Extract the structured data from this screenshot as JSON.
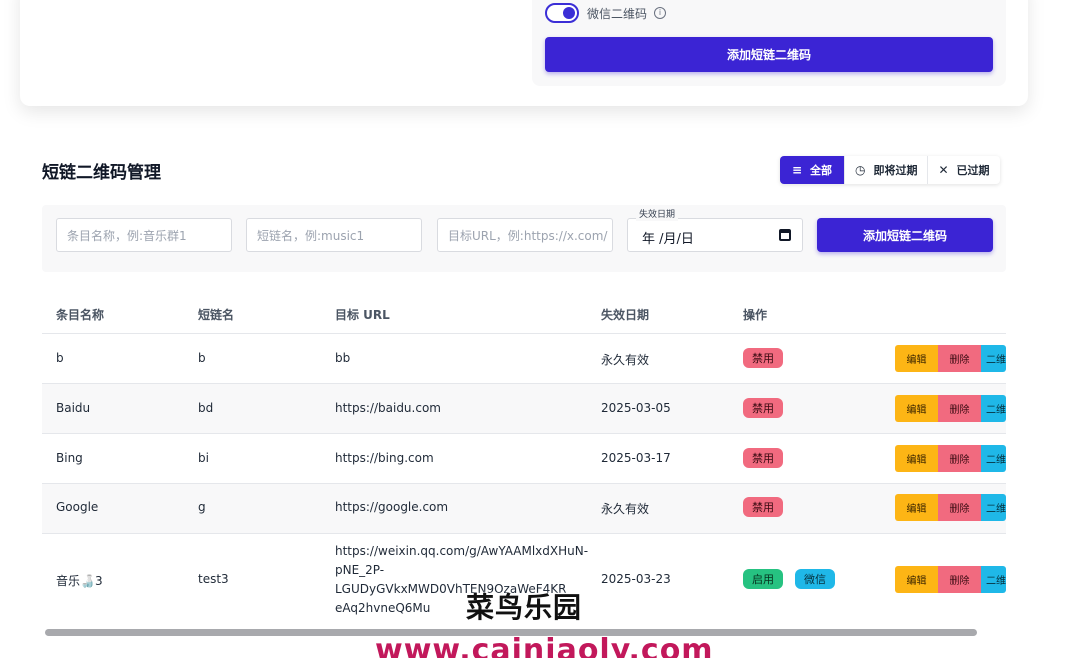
{
  "top_form": {
    "wechat_toggle_label": "微信二维码",
    "wechat_toggle_on": true,
    "info_glyph": "i",
    "add_button": "添加短链二维码"
  },
  "section": {
    "title": "短链二维码管理",
    "filters": [
      {
        "icon": "list-icon",
        "glyph": "≡",
        "label": "全部",
        "active": true
      },
      {
        "icon": "clock-icon",
        "glyph": "◷",
        "label": "即将过期",
        "active": false
      },
      {
        "icon": "close-icon",
        "glyph": "✕",
        "label": "已过期",
        "active": false
      }
    ]
  },
  "form": {
    "name_placeholder": "条目名称，例:音乐群1",
    "short_placeholder": "短链名，例:music1",
    "url_placeholder": "目标URL，例:https://x.com/",
    "date_label": "失效日期",
    "date_value": "年 /月/日",
    "add_button": "添加短链二维码"
  },
  "table": {
    "headers": [
      "条目名称",
      "短链名",
      "目标 URL",
      "失效日期",
      "操作"
    ],
    "actions": {
      "edit": "编辑",
      "delete": "删除",
      "qr": "二维"
    },
    "rows": [
      {
        "name": "b",
        "short": "b",
        "url": "bb",
        "expiry": "永久有效",
        "status": "禁用"
      },
      {
        "name": "Baidu",
        "short": "bd",
        "url": "https://baidu.com",
        "expiry": "2025-03-05",
        "status": "禁用"
      },
      {
        "name": "Bing",
        "short": "bi",
        "url": "https://bing.com",
        "expiry": "2025-03-17",
        "status": "禁用"
      },
      {
        "name": "Google",
        "short": "g",
        "url": "https://google.com",
        "expiry": "永久有效",
        "status": "禁用"
      },
      {
        "name": "音乐🍶3",
        "short": "test3",
        "url_lines": [
          "https://weixin.qq.com/g/AwYAAMlxdXHuN-",
          "pNE_2P-",
          "LGUDyGVkxMWD0VhTEN9OzaWeF4KR",
          "eAq2hvneQ6Mu"
        ],
        "expiry": "2025-03-23",
        "status": "启用",
        "tag": "微信"
      }
    ]
  },
  "watermark": {
    "line1": "菜鸟乐园",
    "line2": "www.cainiaoly.com"
  },
  "colors": {
    "primary": "#3b24d4",
    "danger": "#f16a7f",
    "success": "#26c281",
    "info": "#1fb8e8",
    "warning": "#fdb515"
  }
}
